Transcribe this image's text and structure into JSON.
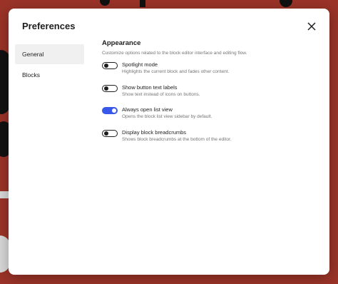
{
  "dialog": {
    "title": "Preferences",
    "close_icon": "close-icon"
  },
  "sidebar": {
    "items": [
      {
        "label": "General",
        "active": true
      },
      {
        "label": "Blocks",
        "active": false
      }
    ]
  },
  "section": {
    "title": "Appearance",
    "description": "Customize options related to the block editor interface and editing flow."
  },
  "options": [
    {
      "label": "Spotlight mode",
      "help": "Highlights the current block and fades other content.",
      "enabled": false
    },
    {
      "label": "Show button text labels",
      "help": "Show text instead of icons on buttons.",
      "enabled": false
    },
    {
      "label": "Always open list view",
      "help": "Opens the block list view sidebar by default.",
      "enabled": true
    },
    {
      "label": "Display block breadcrumbs",
      "help": "Shows block breadcrumbs at the bottom of the editor.",
      "enabled": false
    }
  ],
  "colors": {
    "accent": "#3858e9",
    "backdrop": "#9b3328"
  }
}
